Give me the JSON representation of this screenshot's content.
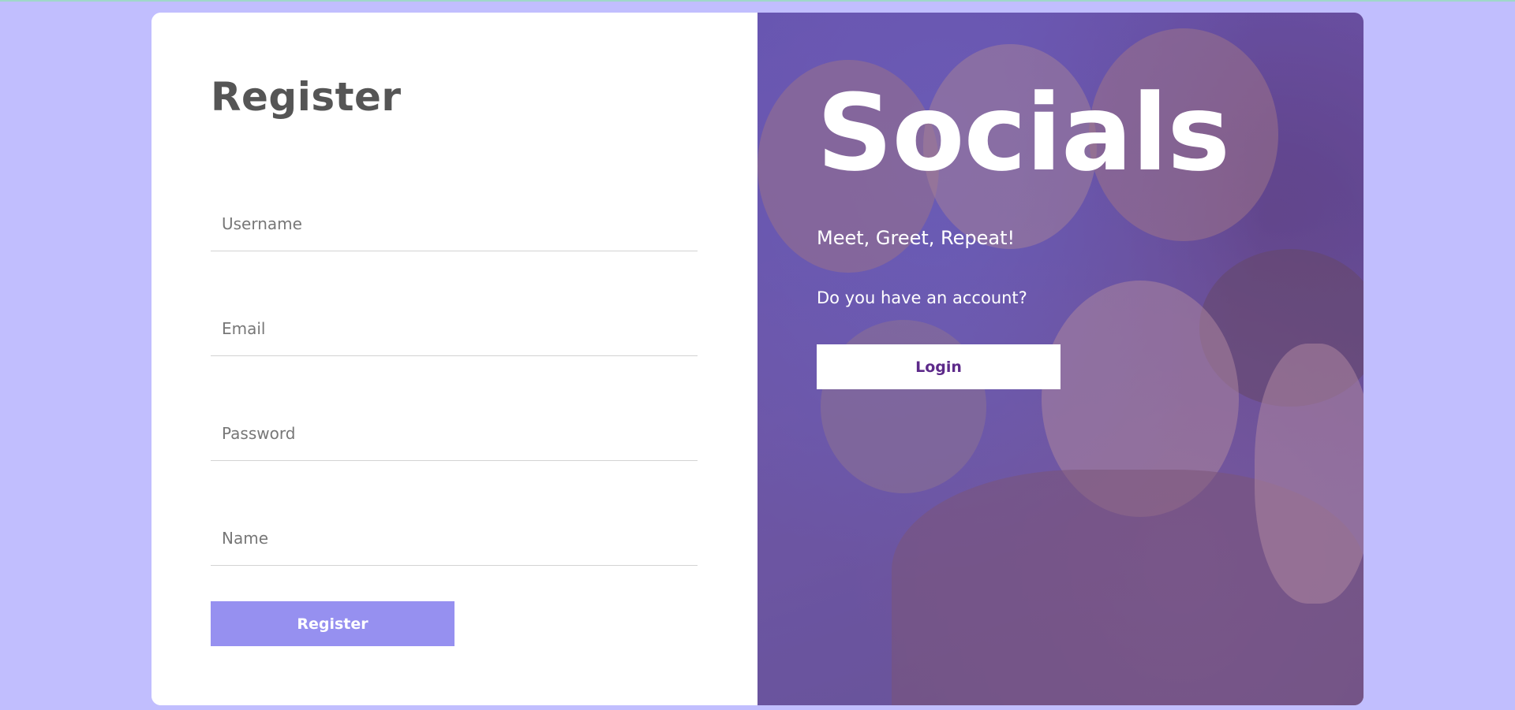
{
  "register": {
    "title": "Register",
    "fields": [
      {
        "placeholder": "Username",
        "value": ""
      },
      {
        "placeholder": "Email",
        "value": ""
      },
      {
        "placeholder": "Password",
        "value": ""
      },
      {
        "placeholder": "Name",
        "value": ""
      }
    ],
    "submit_label": "Register"
  },
  "hero": {
    "brand": "Socials",
    "tagline": "Meet, Greet, Repeat!",
    "question": "Do you have an account?",
    "login_label": "Login"
  },
  "colors": {
    "page_background": "#c1befe",
    "register_button": "#9690f0",
    "title_text": "#555555",
    "login_text": "#5d2a8a"
  }
}
